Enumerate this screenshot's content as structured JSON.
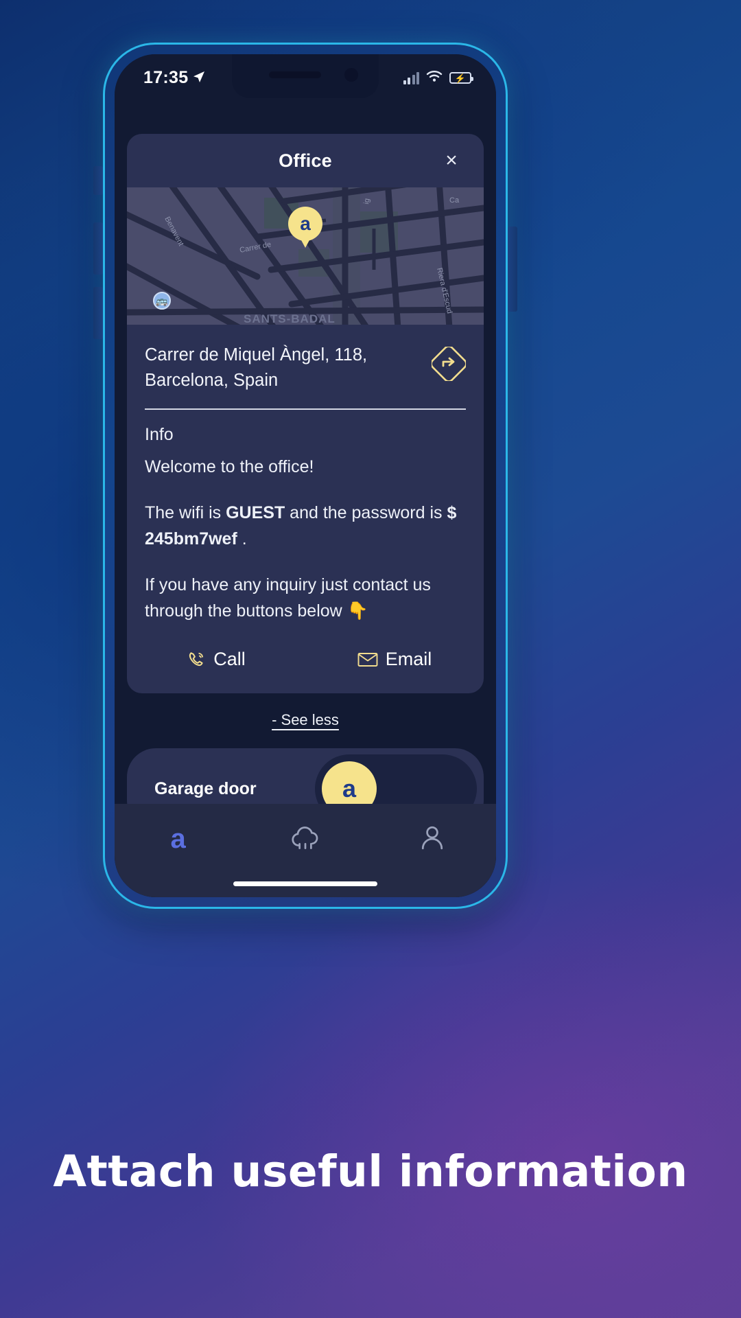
{
  "status_bar": {
    "time": "17:35",
    "location_icon": "location-arrow-icon",
    "signal_icon": "cellular-signal-icon",
    "wifi_icon": "wifi-icon",
    "battery_icon": "battery-charging-icon"
  },
  "card": {
    "title": "Office",
    "close_label": "×",
    "map": {
      "pin_glyph": "a",
      "street_labels": [
        "Benavent",
        "Carrer de",
        "ig",
        "Ca",
        "Riera d'Escud",
        "SANTS-BADAL"
      ],
      "transit_icon": "bus-stop-icon"
    },
    "address": "Carrer de Miquel Àngel, 118, Barcelona, Spain",
    "directions_icon": "directions-arrow-icon",
    "info": {
      "heading": "Info",
      "welcome": "Welcome to the office!",
      "wifi_line_1": "The wifi is ",
      "wifi_ssid": "GUEST",
      "wifi_line_2": " and the password is ",
      "wifi_password": "$ 245bm7wef",
      "wifi_line_3": " .",
      "inquiry": "If you have any inquiry just contact us through the buttons below ",
      "inquiry_emoji": "👇"
    },
    "actions": [
      {
        "label": "Call",
        "icon": "phone-call-icon"
      },
      {
        "label": "Email",
        "icon": "envelope-icon"
      }
    ]
  },
  "see_less": "- See less",
  "device": {
    "name": "Garage door",
    "toggle_glyph": "a",
    "toggle_state": "locked"
  },
  "bottom_nav": [
    {
      "icon": "app-logo-icon",
      "label": "a",
      "active": true
    },
    {
      "icon": "cloud-lock-icon",
      "label": "",
      "active": false
    },
    {
      "icon": "person-icon",
      "label": "",
      "active": false
    }
  ],
  "caption": "Attach useful information",
  "colors": {
    "accent_yellow": "#f6e38c",
    "card_bg": "#2b3154",
    "screen_bg": "#121a33",
    "nav_active": "#5b6fe0",
    "frame_border": "#2bb7e8"
  }
}
